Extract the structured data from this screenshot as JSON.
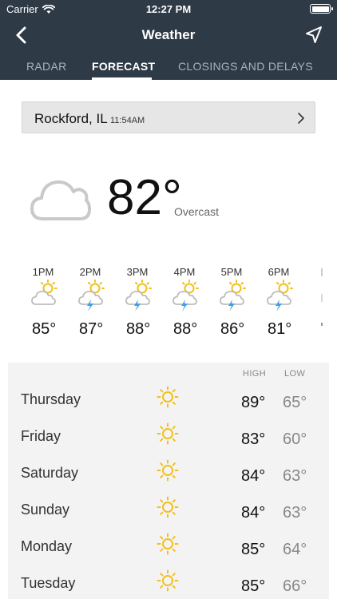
{
  "status_bar": {
    "carrier": "Carrier",
    "time": "12:27 PM"
  },
  "nav": {
    "title": "Weather"
  },
  "tabs": [
    {
      "label": "RADAR"
    },
    {
      "label": "FORECAST"
    },
    {
      "label": "CLOSINGS AND DELAYS"
    }
  ],
  "location": {
    "city": "Rockford, IL",
    "updated": "11:54AM"
  },
  "current": {
    "temp": "82°",
    "condition": "Overcast",
    "icon": "cloud-icon"
  },
  "hourly": [
    {
      "time": "1PM",
      "temp": "85°",
      "icon": "partly-sunny-icon"
    },
    {
      "time": "2PM",
      "temp": "87°",
      "icon": "sun-thunderstorm-icon"
    },
    {
      "time": "3PM",
      "temp": "88°",
      "icon": "sun-thunderstorm-icon"
    },
    {
      "time": "4PM",
      "temp": "88°",
      "icon": "sun-thunderstorm-icon"
    },
    {
      "time": "5PM",
      "temp": "86°",
      "icon": "sun-thunderstorm-icon"
    },
    {
      "time": "6PM",
      "temp": "81°",
      "icon": "sun-thunderstorm-icon"
    }
  ],
  "daily": {
    "high_label": "HIGH",
    "low_label": "LOW",
    "days": [
      {
        "name": "Thursday",
        "high": "89°",
        "low": "65°",
        "icon": "sun-icon"
      },
      {
        "name": "Friday",
        "high": "83°",
        "low": "60°",
        "icon": "sun-icon"
      },
      {
        "name": "Saturday",
        "high": "84°",
        "low": "63°",
        "icon": "sun-icon"
      },
      {
        "name": "Sunday",
        "high": "84°",
        "low": "63°",
        "icon": "sun-icon"
      },
      {
        "name": "Monday",
        "high": "85°",
        "low": "64°",
        "icon": "sun-icon"
      },
      {
        "name": "Tuesday",
        "high": "85°",
        "low": "66°",
        "icon": "sun-icon"
      }
    ]
  },
  "colors": {
    "header_bg": "#2f3a47",
    "sun": "#f2c01d",
    "cloud": "#c9c9c9",
    "bolt": "#3ea0e4"
  }
}
